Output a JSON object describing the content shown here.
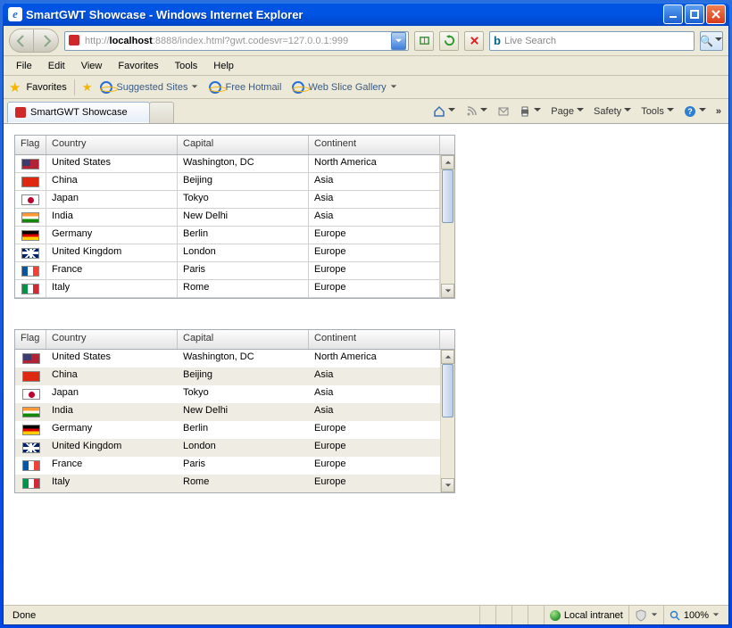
{
  "window": {
    "title": "SmartGWT Showcase - Windows Internet Explorer"
  },
  "address": {
    "prefix": "http://",
    "host": "localhost",
    "suffix": ":8888/index.html?gwt.codesvr=127.0.0.1:999"
  },
  "search": {
    "placeholder": "Live Search"
  },
  "menu": {
    "file": "File",
    "edit": "Edit",
    "view": "View",
    "favorites": "Favorites",
    "tools": "Tools",
    "help": "Help"
  },
  "favbar": {
    "favorites": "Favorites",
    "suggested": "Suggested Sites",
    "hotmail": "Free Hotmail",
    "webslice": "Web Slice Gallery"
  },
  "tabs": {
    "tab0": "SmartGWT Showcase"
  },
  "cmdbar": {
    "page": "Page",
    "safety": "Safety",
    "tools": "Tools"
  },
  "columns": {
    "flag": "Flag",
    "country": "Country",
    "capital": "Capital",
    "continent": "Continent"
  },
  "rows": [
    {
      "flag": "us",
      "country": "United States",
      "capital": "Washington, DC",
      "continent": "North America"
    },
    {
      "flag": "cn",
      "country": "China",
      "capital": "Beijing",
      "continent": "Asia"
    },
    {
      "flag": "jp",
      "country": "Japan",
      "capital": "Tokyo",
      "continent": "Asia"
    },
    {
      "flag": "in",
      "country": "India",
      "capital": "New Delhi",
      "continent": "Asia"
    },
    {
      "flag": "de",
      "country": "Germany",
      "capital": "Berlin",
      "continent": "Europe"
    },
    {
      "flag": "gb",
      "country": "United Kingdom",
      "capital": "London",
      "continent": "Europe"
    },
    {
      "flag": "fr",
      "country": "France",
      "capital": "Paris",
      "continent": "Europe"
    },
    {
      "flag": "it",
      "country": "Italy",
      "capital": "Rome",
      "continent": "Europe"
    }
  ],
  "status": {
    "done": "Done",
    "zone": "Local intranet",
    "zoom": "100%"
  }
}
